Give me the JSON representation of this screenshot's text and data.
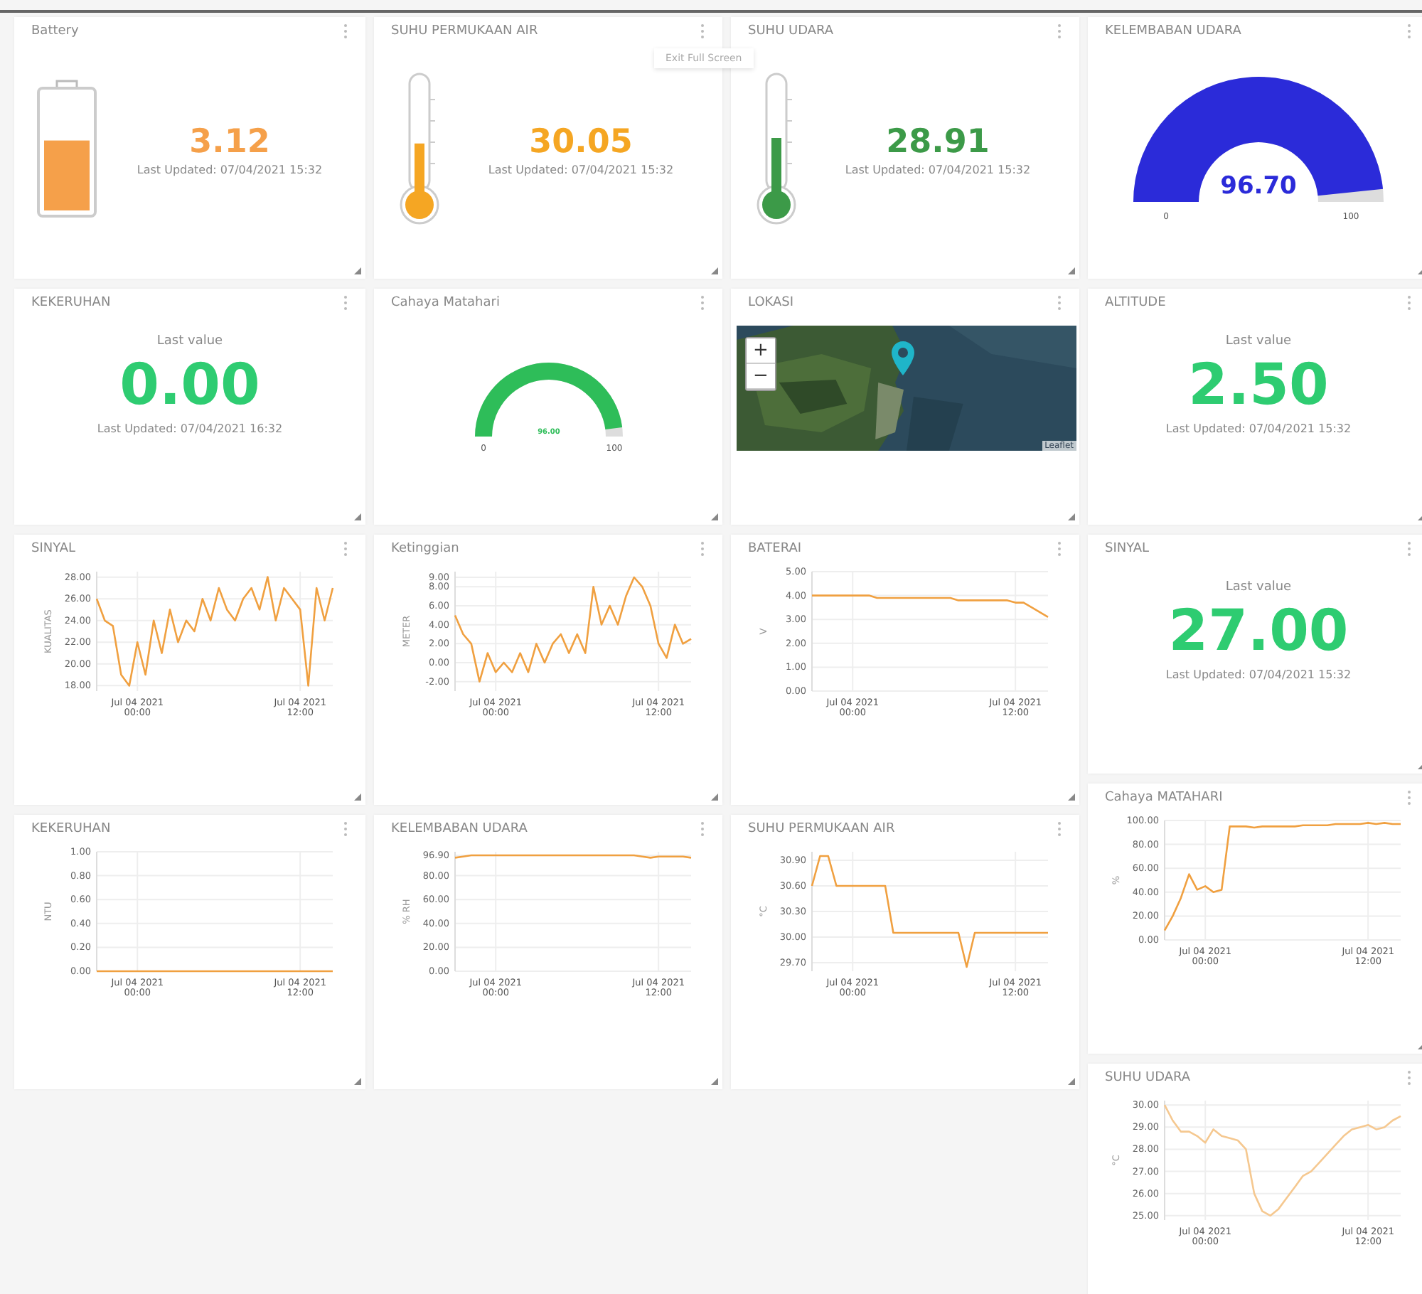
{
  "tooltip": "Exit Full Screen",
  "columns": [
    {
      "cards": [
        {
          "kind": "battery",
          "title": "Battery",
          "value": "3.12",
          "updated": "Last Updated: 07/04/2021 15:32",
          "level": 0.6,
          "color": "#f5a04a"
        },
        {
          "kind": "value",
          "title": "KEKERUHAN",
          "label": "Last value",
          "value": "0.00",
          "updated": "Last Updated: 07/04/2021 16:32",
          "color": "#2ecc71"
        },
        {
          "kind": "chart",
          "title": "SINYAL",
          "chart_data": {
            "type": "line",
            "grid": true,
            "ylabel": "KUALITAS",
            "ylim": [
              17.5,
              28.5
            ],
            "yticks": [
              {
                "value": 18,
                "label": "18.00"
              },
              {
                "value": 20,
                "label": "20.00"
              },
              {
                "value": 22,
                "label": "22.00"
              },
              {
                "value": 24,
                "label": "24.00"
              },
              {
                "value": 26,
                "label": "26.00"
              },
              {
                "value": 28,
                "label": "28.00"
              }
            ],
            "categories": [
              null,
              null,
              null,
              null,
              null,
              "Jul 04 2021 00:00",
              null,
              null,
              null,
              null,
              null,
              null,
              null,
              null,
              null,
              null,
              null,
              null,
              null,
              null,
              null,
              null,
              null,
              null,
              null,
              "Jul 04 2021 12:00",
              null,
              null,
              null,
              null
            ],
            "series": [
              {
                "color": "#f0a040",
                "values": [
                  26,
                  24,
                  23.5,
                  19,
                  18,
                  22,
                  19,
                  24,
                  21,
                  25,
                  22,
                  24,
                  23,
                  26,
                  24,
                  27,
                  25,
                  24,
                  26,
                  27,
                  25,
                  28,
                  24,
                  27,
                  26,
                  25,
                  18,
                  27,
                  24,
                  27
                ]
              }
            ]
          }
        },
        {
          "kind": "chart",
          "title": "KEKERUHAN",
          "chart_data": {
            "type": "line",
            "grid": true,
            "ylabel": "NTU",
            "ylim": [
              0,
              1
            ],
            "yticks": [
              {
                "value": 0,
                "label": "0.00"
              },
              {
                "value": 0.2,
                "label": "0.20"
              },
              {
                "value": 0.4,
                "label": "0.40"
              },
              {
                "value": 0.6,
                "label": "0.60"
              },
              {
                "value": 0.8,
                "label": "0.80"
              },
              {
                "value": 1,
                "label": "1.00"
              }
            ],
            "categories": [
              null,
              null,
              null,
              null,
              null,
              "Jul 04 2021 00:00",
              null,
              null,
              null,
              null,
              null,
              null,
              null,
              null,
              null,
              null,
              null,
              null,
              null,
              null,
              null,
              null,
              null,
              null,
              null,
              "Jul 04 2021 12:00",
              null,
              null,
              null,
              null
            ],
            "series": [
              {
                "color": "#f0a040",
                "values": [
                  0,
                  0,
                  0,
                  0,
                  0,
                  0,
                  0,
                  0,
                  0,
                  0,
                  0,
                  0,
                  0,
                  0,
                  0,
                  0,
                  0,
                  0,
                  0,
                  0,
                  0,
                  0,
                  0,
                  0,
                  0,
                  0,
                  0,
                  0,
                  0,
                  0
                ]
              }
            ]
          }
        }
      ]
    },
    {
      "cards": [
        {
          "kind": "thermometer",
          "title": "SUHU PERMUKAAN AIR",
          "value": "30.05",
          "updated": "Last Updated: 07/04/2021 15:32",
          "level": 0.45,
          "color": "#f5a623"
        },
        {
          "kind": "gauge",
          "title": "Cahaya Matahari",
          "value": "96.00",
          "min": "0",
          "max": "100",
          "level": 0.96,
          "color": "#2ebd59"
        },
        {
          "kind": "chart",
          "title": "Ketinggian",
          "chart_data": {
            "type": "line",
            "grid": true,
            "ylabel": "METER",
            "ylim": [
              -3,
              9.6
            ],
            "yticks": [
              {
                "value": -2,
                "label": "-2.00"
              },
              {
                "value": 0,
                "label": "0.00"
              },
              {
                "value": 2,
                "label": "2.00"
              },
              {
                "value": 4,
                "label": "4.00"
              },
              {
                "value": 6,
                "label": "6.00"
              },
              {
                "value": 8,
                "label": "8.00"
              },
              {
                "value": 9,
                "label": "9.00"
              }
            ],
            "categories": [
              null,
              null,
              null,
              null,
              null,
              "Jul 04 2021 00:00",
              null,
              null,
              null,
              null,
              null,
              null,
              null,
              null,
              null,
              null,
              null,
              null,
              null,
              null,
              null,
              null,
              null,
              null,
              null,
              "Jul 04 2021 12:00",
              null,
              null,
              null,
              null
            ],
            "series": [
              {
                "color": "#f0a040",
                "values": [
                  5,
                  3,
                  2,
                  -2,
                  1,
                  -1,
                  0,
                  -1,
                  1,
                  -1,
                  2,
                  0,
                  2,
                  3,
                  1,
                  3,
                  1,
                  8,
                  4,
                  6,
                  4,
                  7,
                  9,
                  8,
                  6,
                  2,
                  0.5,
                  4,
                  2,
                  2.5
                ]
              }
            ]
          }
        },
        {
          "kind": "chart",
          "title": "KELEMBABAN UDARA",
          "chart_data": {
            "type": "line",
            "grid": true,
            "ylabel": "% RH",
            "ylim": [
              0,
              100
            ],
            "yticks": [
              {
                "value": 0,
                "label": "0.00"
              },
              {
                "value": 20,
                "label": "20.00"
              },
              {
                "value": 40,
                "label": "40.00"
              },
              {
                "value": 60,
                "label": "60.00"
              },
              {
                "value": 80,
                "label": "80.00"
              },
              {
                "value": 96.9,
                "label": "96.90"
              }
            ],
            "categories": [
              null,
              null,
              null,
              null,
              null,
              "Jul 04 2021 00:00",
              null,
              null,
              null,
              null,
              null,
              null,
              null,
              null,
              null,
              null,
              null,
              null,
              null,
              null,
              null,
              null,
              null,
              null,
              null,
              "Jul 04 2021 12:00",
              null,
              null,
              null,
              null
            ],
            "series": [
              {
                "color": "#f0a040",
                "values": [
                  95,
                  96,
                  97,
                  97,
                  97,
                  97,
                  97,
                  97,
                  97,
                  97,
                  97,
                  97,
                  97,
                  97,
                  97,
                  97,
                  97,
                  97,
                  97,
                  97,
                  97,
                  97,
                  97,
                  96,
                  95,
                  96,
                  96,
                  96,
                  96,
                  95
                ]
              }
            ]
          }
        }
      ]
    },
    {
      "cards": [
        {
          "kind": "thermometer",
          "title": "SUHU UDARA",
          "value": "28.91",
          "updated": "Last Updated: 07/04/2021 15:32",
          "level": 0.5,
          "color": "#3c9a48"
        },
        {
          "title": "LOKASI",
          "zoom_in": "+",
          "zoom_out": "−",
          "attribution": "Leaflet"
        },
        {
          "kind": "chart",
          "title": "BATERAI",
          "chart_data": {
            "type": "line",
            "grid": true,
            "ylabel": "V",
            "ylim": [
              0,
              5
            ],
            "yticks": [
              {
                "value": 0,
                "label": "0.00"
              },
              {
                "value": 1,
                "label": "1.00"
              },
              {
                "value": 2,
                "label": "2.00"
              },
              {
                "value": 3,
                "label": "3.00"
              },
              {
                "value": 4,
                "label": "4.00"
              },
              {
                "value": 5,
                "label": "5.00"
              }
            ],
            "categories": [
              null,
              null,
              null,
              null,
              null,
              "Jul 04 2021 00:00",
              null,
              null,
              null,
              null,
              null,
              null,
              null,
              null,
              null,
              null,
              null,
              null,
              null,
              null,
              null,
              null,
              null,
              null,
              null,
              "Jul 04 2021 12:00",
              null,
              null,
              null,
              null
            ],
            "series": [
              {
                "color": "#f0a040",
                "values": [
                  4,
                  4,
                  4,
                  4,
                  4,
                  4,
                  4,
                  4,
                  3.9,
                  3.9,
                  3.9,
                  3.9,
                  3.9,
                  3.9,
                  3.9,
                  3.9,
                  3.9,
                  3.9,
                  3.8,
                  3.8,
                  3.8,
                  3.8,
                  3.8,
                  3.8,
                  3.8,
                  3.7,
                  3.7,
                  3.5,
                  3.3,
                  3.1
                ]
              }
            ]
          }
        },
        {
          "kind": "chart",
          "title": "SUHU PERMUKAAN AIR",
          "chart_data": {
            "type": "line",
            "grid": true,
            "ylabel": "°C",
            "ylim": [
              29.6,
              31.0
            ],
            "yticks": [
              {
                "value": 29.7,
                "label": "29.70"
              },
              {
                "value": 30,
                "label": "30.00"
              },
              {
                "value": 30.3,
                "label": "30.30"
              },
              {
                "value": 30.6,
                "label": "30.60"
              },
              {
                "value": 30.9,
                "label": "30.90"
              }
            ],
            "categories": [
              null,
              null,
              null,
              null,
              null,
              "Jul 04 2021 00:00",
              null,
              null,
              null,
              null,
              null,
              null,
              null,
              null,
              null,
              null,
              null,
              null,
              null,
              null,
              null,
              null,
              null,
              null,
              null,
              "Jul 04 2021 12:00",
              null,
              null,
              null,
              null
            ],
            "series": [
              {
                "color": "#f0a040",
                "values": [
                  30.6,
                  30.95,
                  30.95,
                  30.6,
                  30.6,
                  30.6,
                  30.6,
                  30.6,
                  30.6,
                  30.6,
                  30.05,
                  30.05,
                  30.05,
                  30.05,
                  30.05,
                  30.05,
                  30.05,
                  30.05,
                  30.05,
                  29.65,
                  30.05,
                  30.05,
                  30.05,
                  30.05,
                  30.05,
                  30.05,
                  30.05,
                  30.05,
                  30.05,
                  30.05
                ]
              }
            ]
          }
        }
      ]
    },
    {
      "cards": [
        {
          "kind": "gauge",
          "title": "KELEMBABAN UDARA",
          "value": "96.70",
          "min": "0",
          "max": "100",
          "level": 0.967,
          "color": "#2b2bd9"
        },
        {
          "kind": "value",
          "title": "ALTITUDE",
          "label": "Last value",
          "value": "2.50",
          "updated": "Last Updated: 07/04/2021 15:32",
          "color": "#2ecc71"
        },
        {
          "kind": "value",
          "title": "SINYAL",
          "label": "Last value",
          "value": "27.00",
          "updated": "Last Updated: 07/04/2021 15:32",
          "color": "#2ecc71"
        },
        {
          "kind": "chart",
          "title": "Cahaya MATAHARI",
          "chart_data": {
            "type": "line",
            "grid": true,
            "ylabel": "%",
            "ylim": [
              0,
              100
            ],
            "yticks": [
              {
                "value": 0,
                "label": "0.00"
              },
              {
                "value": 20,
                "label": "20.00"
              },
              {
                "value": 40,
                "label": "40.00"
              },
              {
                "value": 60,
                "label": "60.00"
              },
              {
                "value": 80,
                "label": "80.00"
              },
              {
                "value": 100,
                "label": "100.00"
              }
            ],
            "categories": [
              null,
              null,
              null,
              null,
              null,
              "Jul 04 2021 00:00",
              null,
              null,
              null,
              null,
              null,
              null,
              null,
              null,
              null,
              null,
              null,
              null,
              null,
              null,
              null,
              null,
              null,
              null,
              null,
              "Jul 04 2021 12:00",
              null,
              null,
              null,
              null
            ],
            "series": [
              {
                "color": "#f0a040",
                "values": [
                  8,
                  20,
                  35,
                  55,
                  42,
                  45,
                  40,
                  42,
                  95,
                  95,
                  95,
                  94,
                  95,
                  95,
                  95,
                  95,
                  95,
                  96,
                  96,
                  96,
                  96,
                  97,
                  97,
                  97,
                  97,
                  98,
                  97,
                  98,
                  97,
                  97
                ]
              }
            ]
          }
        },
        {
          "kind": "chart",
          "title": "SUHU UDARA",
          "chart_data": {
            "type": "line",
            "grid": true,
            "ylabel": "°C",
            "ylim": [
              24.8,
              30.2
            ],
            "yticks": [
              {
                "value": 25,
                "label": "25.00"
              },
              {
                "value": 26,
                "label": "26.00"
              },
              {
                "value": 27,
                "label": "27.00"
              },
              {
                "value": 28,
                "label": "28.00"
              },
              {
                "value": 29,
                "label": "29.00"
              },
              {
                "value": 30,
                "label": "30.00"
              }
            ],
            "categories": [
              null,
              null,
              null,
              null,
              null,
              "Jul 04 2021 00:00",
              null,
              null,
              null,
              null,
              null,
              null,
              null,
              null,
              null,
              null,
              null,
              null,
              null,
              null,
              null,
              null,
              null,
              null,
              null,
              "Jul 04 2021 12:00",
              null,
              null,
              null,
              null
            ],
            "series": [
              {
                "color": "#f5c890",
                "values": [
                  30,
                  29.3,
                  28.8,
                  28.8,
                  28.6,
                  28.3,
                  28.9,
                  28.6,
                  28.5,
                  28.4,
                  28,
                  26,
                  25.2,
                  25,
                  25.3,
                  25.8,
                  26.3,
                  26.8,
                  27,
                  27.4,
                  27.8,
                  28.2,
                  28.6,
                  28.9,
                  29,
                  29.1,
                  28.9,
                  29,
                  29.3,
                  29.5
                ]
              }
            ]
          }
        }
      ]
    }
  ]
}
